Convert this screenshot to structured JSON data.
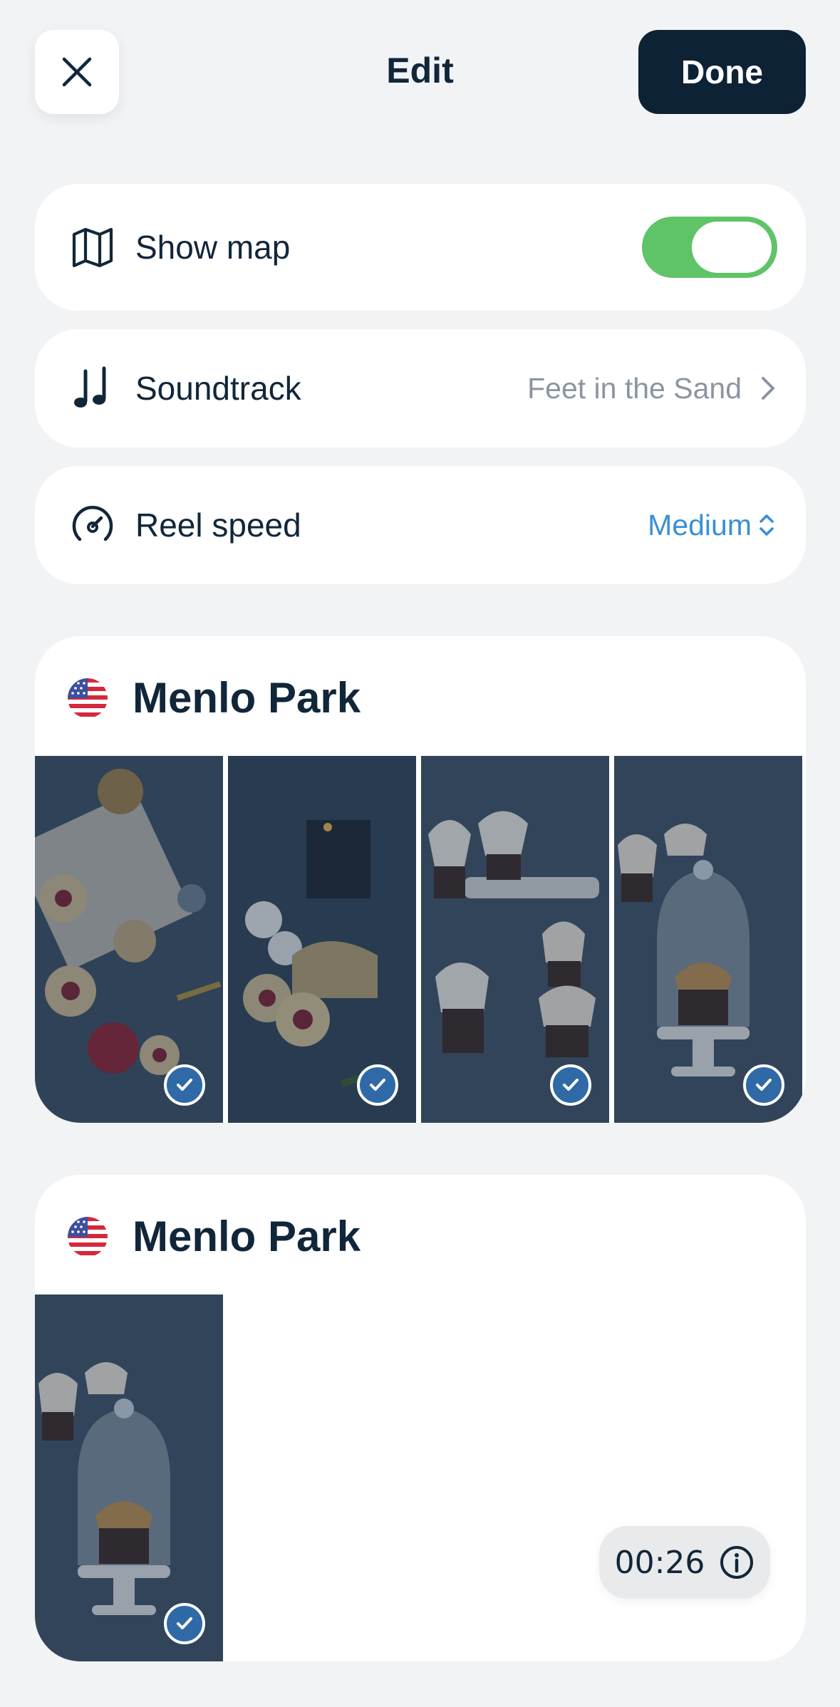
{
  "header": {
    "title": "Edit",
    "close_icon": "close-icon",
    "done_label": "Done"
  },
  "settings": {
    "show_map": {
      "label": "Show map",
      "icon": "map-icon",
      "enabled": true
    },
    "soundtrack": {
      "label": "Soundtrack",
      "icon": "music-note-icon",
      "value": "Feet in the Sand"
    },
    "reel_speed": {
      "label": "Reel speed",
      "icon": "speedometer-icon",
      "value": "Medium"
    }
  },
  "groups": [
    {
      "title": "Menlo Park",
      "flag": "us-flag-icon",
      "photos": [
        "cookies-box",
        "cookies-candle",
        "cupcakes-stand",
        "cupcake-dome"
      ],
      "selected": [
        true,
        true,
        true,
        true
      ]
    },
    {
      "title": "Menlo Park",
      "flag": "us-flag-icon",
      "photos": [
        "cupcake-dome"
      ],
      "selected": [
        true
      ]
    }
  ],
  "duration": {
    "time": "00:26",
    "icon": "info-icon"
  },
  "colors": {
    "accent_dark": "#0e2236",
    "toggle_on": "#5ec467",
    "link_blue": "#3a8fd6",
    "check_blue": "#2f6aa6",
    "background": "#f2f3f5"
  }
}
